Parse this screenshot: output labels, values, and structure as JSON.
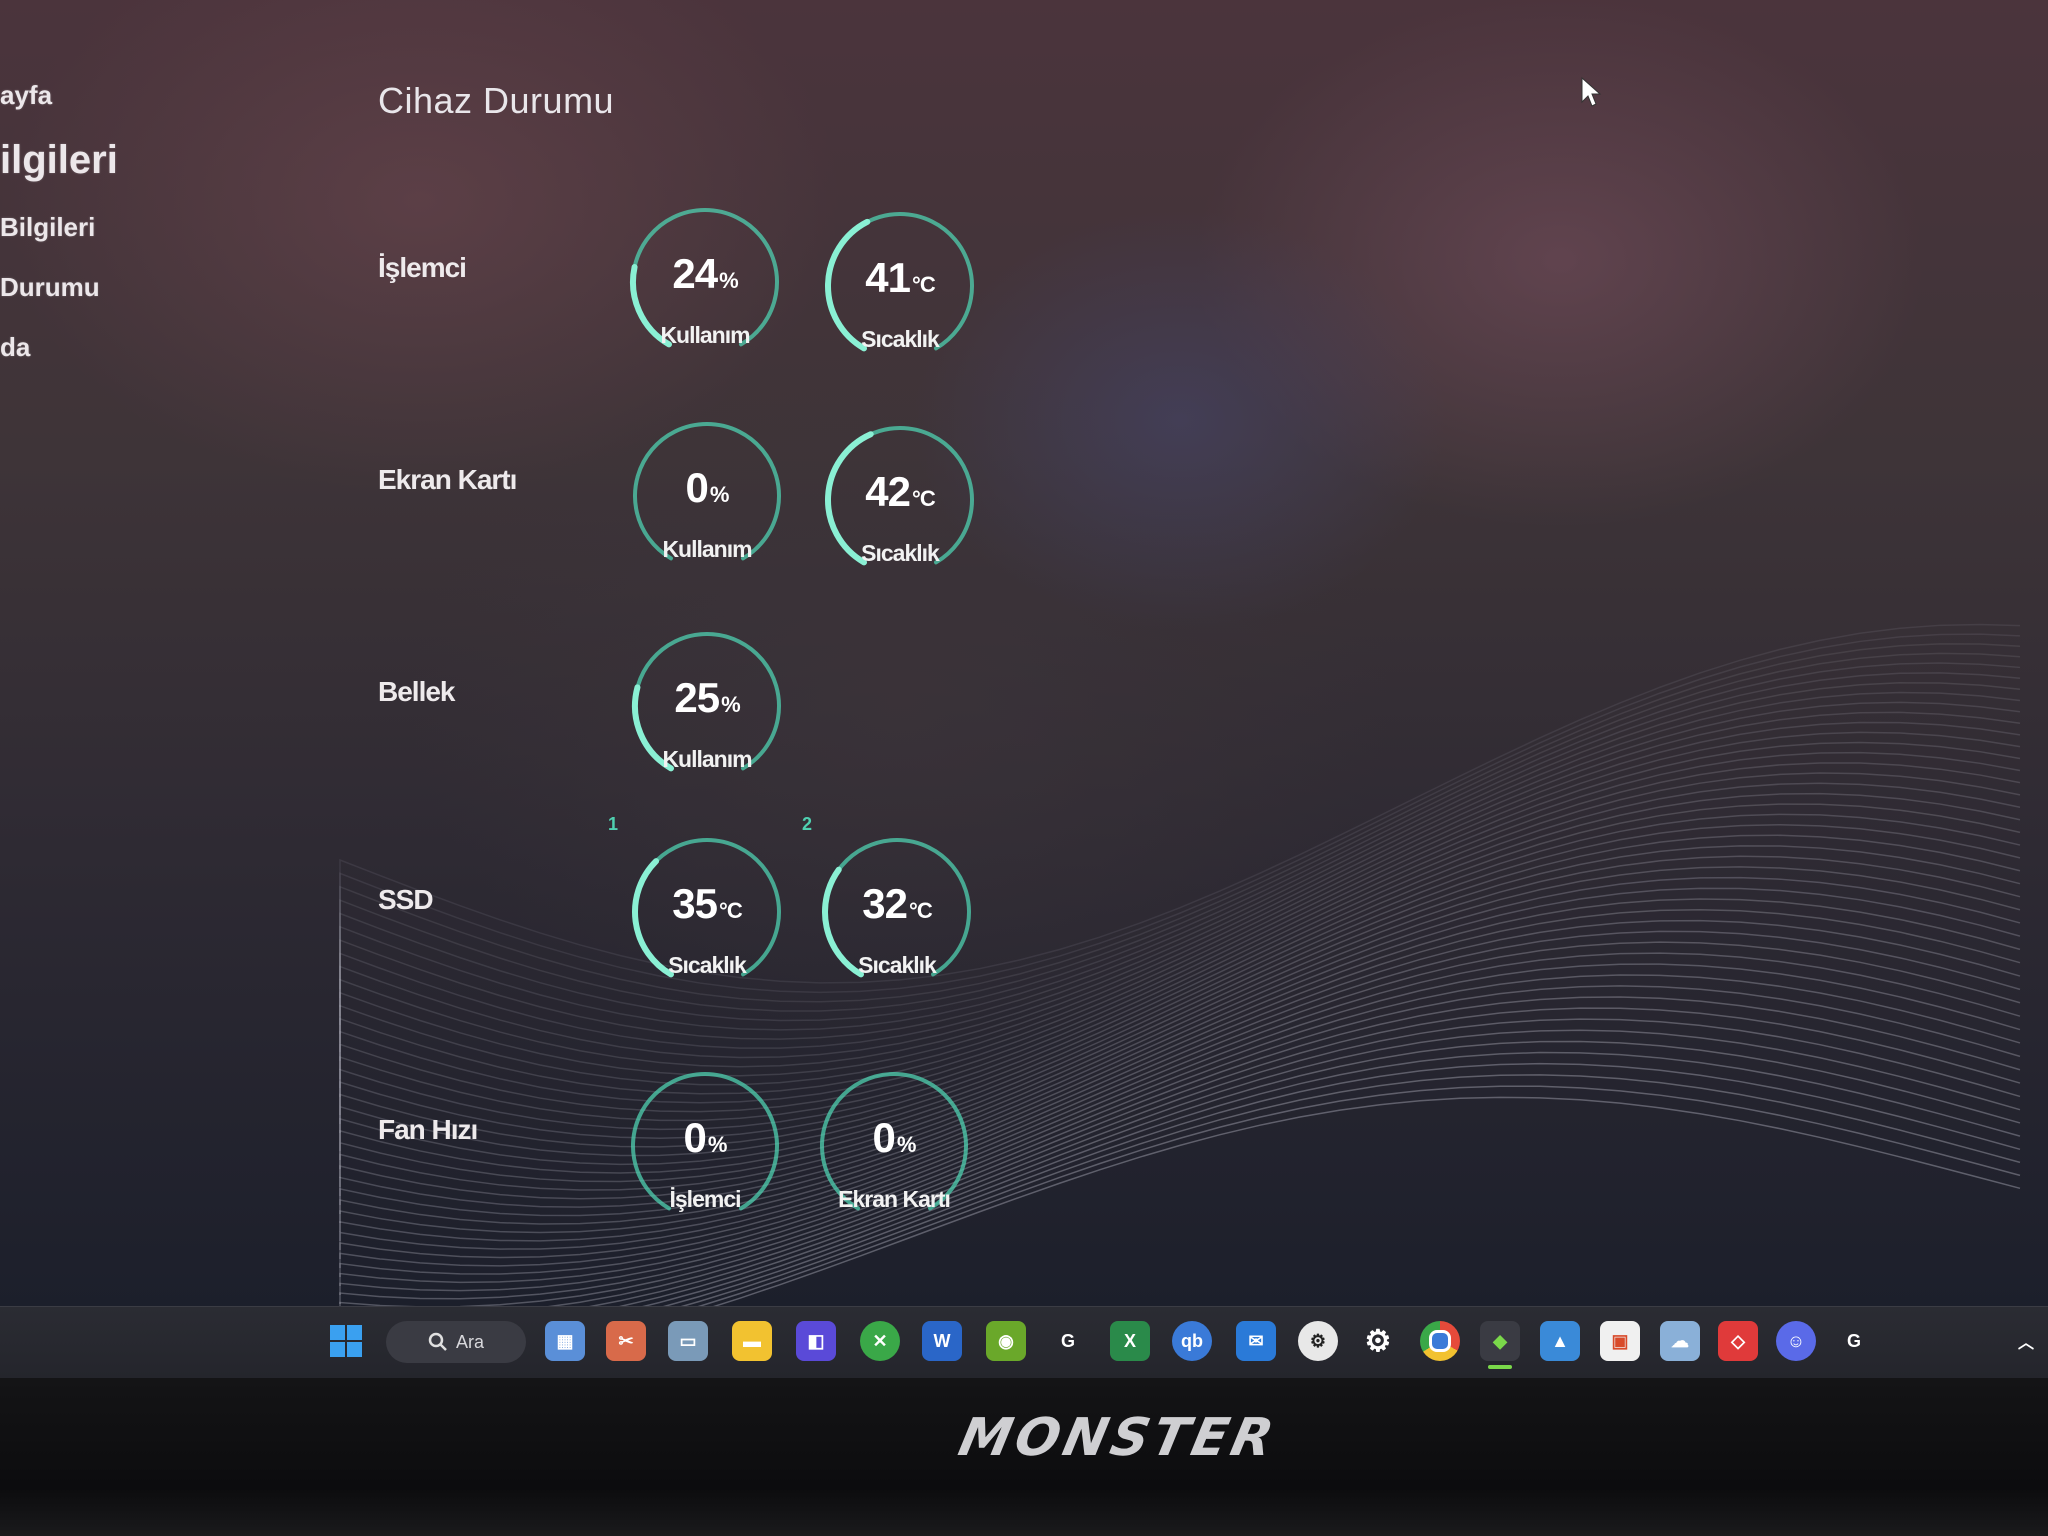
{
  "sidebar": {
    "items": [
      {
        "label": "ayfa"
      },
      {
        "label": "ilgileri"
      },
      {
        "label": "Bilgileri"
      },
      {
        "label": "Durumu"
      },
      {
        "label": "da"
      }
    ]
  },
  "page": {
    "title": "Cihaz Durumu"
  },
  "rows": {
    "cpu": {
      "label": "İşlemci",
      "usage": {
        "value": "24",
        "unit": "%",
        "caption": "Kullanım",
        "fraction": 0.24
      },
      "temp": {
        "value": "41",
        "unit": "°C",
        "caption": "Sıcaklık",
        "fraction": 0.41
      }
    },
    "gpu": {
      "label": "Ekran Kartı",
      "usage": {
        "value": "0",
        "unit": "%",
        "caption": "Kullanım",
        "fraction": 0.0
      },
      "temp": {
        "value": "42",
        "unit": "°C",
        "caption": "Sıcaklık",
        "fraction": 0.42
      }
    },
    "memory": {
      "label": "Bellek",
      "usage": {
        "value": "25",
        "unit": "%",
        "caption": "Kullanım",
        "fraction": 0.25
      }
    },
    "ssd": {
      "label": "SSD",
      "disk1": {
        "index": "1",
        "value": "35",
        "unit": "°C",
        "caption": "Sıcaklık",
        "fraction": 0.35
      },
      "disk2": {
        "index": "2",
        "value": "32",
        "unit": "°C",
        "caption": "Sıcaklık",
        "fraction": 0.32
      }
    },
    "fan": {
      "label": "Fan Hızı",
      "cpu": {
        "value": "0",
        "unit": "%",
        "caption": "İşlemci",
        "fraction": 0.0
      },
      "gpu": {
        "value": "0",
        "unit": "%",
        "caption": "Ekran Kartı",
        "fraction": 0.0
      }
    }
  },
  "taskbar": {
    "search_label": "Ara",
    "icons": [
      "windows-start",
      "search",
      "widgets",
      "snipping-tool",
      "file-explorer-window",
      "file-explorer",
      "photo-editor",
      "xbox",
      "word",
      "nvidia",
      "logitech",
      "excel",
      "qbittorrent",
      "outlook",
      "steam",
      "settings",
      "chrome",
      "monster-control-center",
      "photos",
      "microsoft-store",
      "weather",
      "anydesk",
      "discord",
      "logitech-ghub"
    ]
  },
  "colors": {
    "accent": "#4fd0b0",
    "text": "#ffffff"
  },
  "brand": {
    "logo": "MONSTER"
  }
}
